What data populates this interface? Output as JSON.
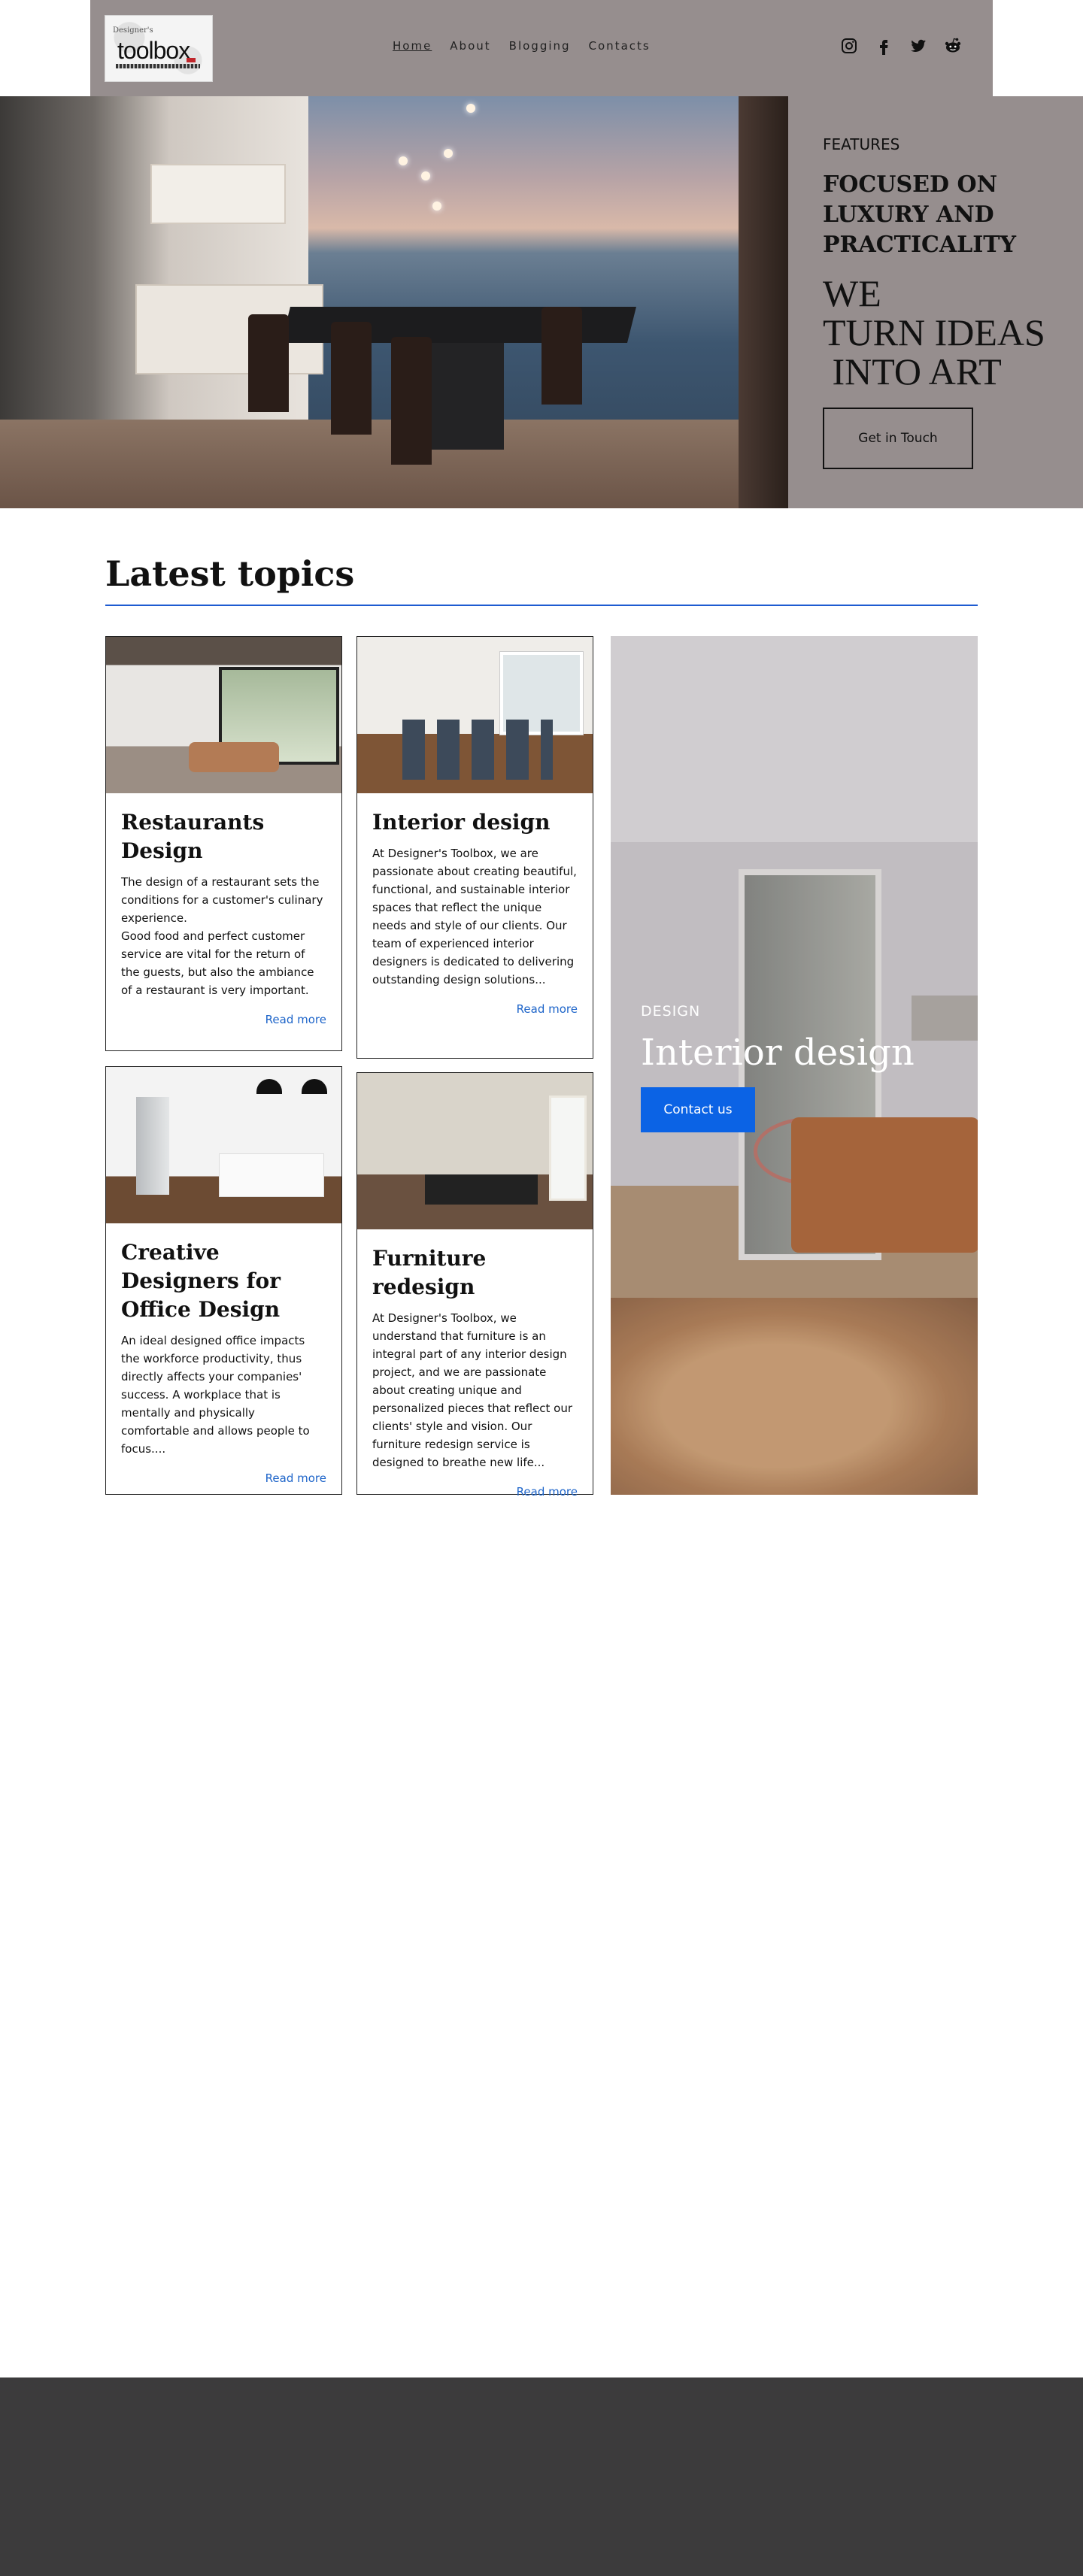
{
  "header": {
    "logo_small": "Designer's",
    "logo_main": "toolbox",
    "nav": [
      {
        "label": "Home"
      },
      {
        "label": "About"
      },
      {
        "label": "Blogging"
      },
      {
        "label": "Contacts"
      }
    ],
    "social": [
      "instagram-icon",
      "facebook-icon",
      "twitter-icon",
      "reddit-icon"
    ]
  },
  "hero": {
    "kicker": "FEATURES",
    "headline": "FOCUSED ON LUXURY AND PRACTICALITY",
    "tagline": "WE\nTURN IDEAS\n INTO ART",
    "button": "Get in Touch"
  },
  "topics": {
    "title": "Latest topics",
    "accent_color": "#1e5bd1",
    "cards": [
      {
        "title": "Restaurants Design",
        "text": "The design of a restaurant sets the conditions for a customer's culinary experience.\nGood food and perfect customer service are vital for the return of the guests, but also the ambiance of a restaurant is very important.",
        "more": "Read more"
      },
      {
        "title": "Interior design",
        "text": "At Designer's Toolbox, we are passionate about creating beautiful, functional, and sustainable interior spaces that reflect the unique needs and style of our clients. Our team of experienced interior designers is dedicated to delivering outstanding design solutions...",
        "more": "Read more"
      },
      {
        "title": "Creative Designers for Office Design",
        "text": "An ideal designed office impacts the workforce productivity, thus directly affects your companies' success. A workplace that is mentally and physically comfortable and allows people to focus....",
        "more": "Read more"
      },
      {
        "title": "Furniture redesign",
        "text": "At Designer's Toolbox, we understand that furniture is an integral part of any interior design project, and we are passionate about creating unique and personalized pieces that reflect our clients' style and vision. Our furniture redesign service is designed to breathe new life...",
        "more": "Read more"
      }
    ],
    "feature": {
      "kicker": "DESIGN",
      "title": "Interior design",
      "button": "Contact us",
      "button_color": "#0b63e5"
    }
  }
}
